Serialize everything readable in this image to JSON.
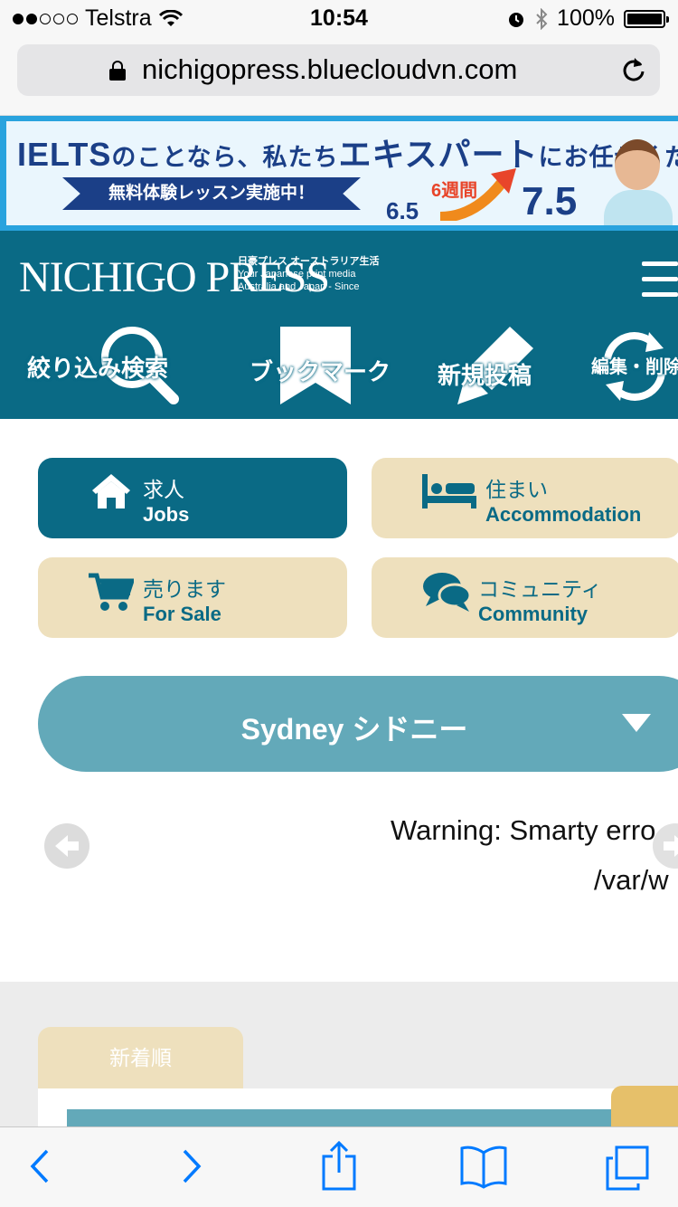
{
  "status_bar": {
    "carrier": "Telstra",
    "time": "10:54",
    "battery": "100%"
  },
  "browser": {
    "url": "nichigopress.bluecloudvn.com"
  },
  "banner": {
    "title_latin": "IELTS",
    "title_1": "のことなら、私たち",
    "title_2": "エキスパート",
    "title_3": "にお任せください",
    "ribbon": "無料体験レッスン実施中！",
    "weeks": "6週間",
    "score_from": "6.5",
    "score_to": "7.5"
  },
  "header": {
    "logo": "NICHIGO PRESS",
    "logo_sub_jp": "日豪プレス オーストラリア生活",
    "logo_sub_1": "Your Japanese print media",
    "logo_sub_2": "Australia and Japan - Since",
    "nav": [
      {
        "label": "絞り込み検索",
        "icon": "magnifier-icon"
      },
      {
        "label": "ブックマーク",
        "icon": "bookmark-icon"
      },
      {
        "label": "新規投稿",
        "icon": "pencil-icon"
      },
      {
        "label": "編集・削除",
        "icon": "cycle-icon"
      }
    ]
  },
  "categories": [
    {
      "jp": "求人",
      "en": "Jobs",
      "icon": "home-icon",
      "active": true
    },
    {
      "jp": "住まい",
      "en": "Accommodation",
      "icon": "bed-icon",
      "active": false
    },
    {
      "jp": "売ります",
      "en": "For Sale",
      "icon": "cart-icon",
      "active": false
    },
    {
      "jp": "コミュニティ",
      "en": "Community",
      "icon": "chat-icon",
      "active": false
    }
  ],
  "region": {
    "label": "Sydney シドニー"
  },
  "warning": {
    "line1": "Warning: Smarty erro",
    "line2": "/var/w"
  },
  "listing": {
    "sort_tab": "新着順"
  },
  "colors": {
    "primary": "#0a6a85",
    "beige": "#eee0bd",
    "region": "#63a9b9",
    "ios_blue": "#007aff"
  }
}
